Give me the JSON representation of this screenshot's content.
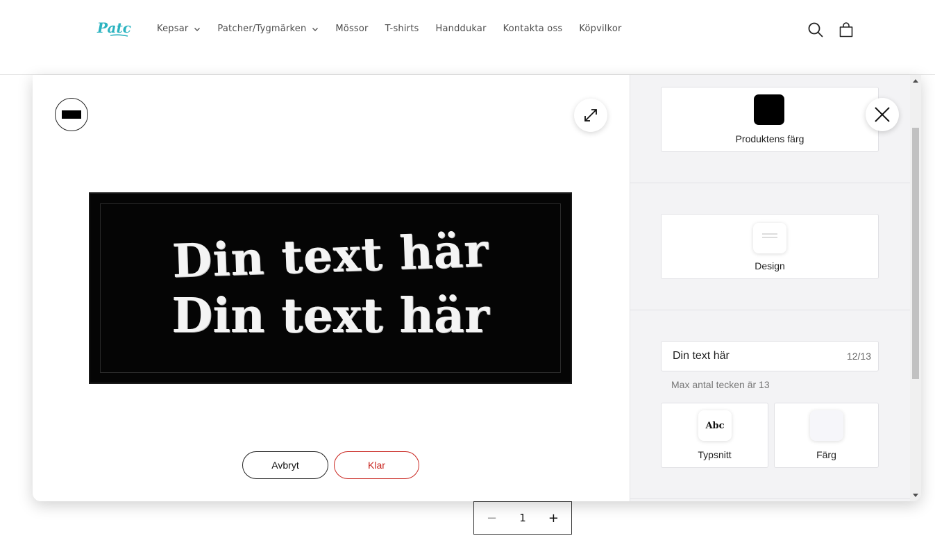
{
  "header": {
    "logo_text": "Patch",
    "nav": [
      {
        "label": "Kepsar",
        "dropdown": true
      },
      {
        "label": "Patcher/Tygmärken",
        "dropdown": true
      },
      {
        "label": "Mössor",
        "dropdown": false
      },
      {
        "label": "T-shirts",
        "dropdown": false
      },
      {
        "label": "Handdukar",
        "dropdown": false
      },
      {
        "label": "Kontakta oss",
        "dropdown": false
      },
      {
        "label": "Köpvilkor",
        "dropdown": false
      }
    ],
    "icons": [
      "search-icon",
      "cart-icon"
    ]
  },
  "quantity": {
    "minus": "−",
    "value": "1",
    "plus": "+"
  },
  "editor": {
    "patch": {
      "line1": "Din text här",
      "line2": "Din text här",
      "background_color": "#050505",
      "text_color": "#f4f4f4"
    },
    "buttons": {
      "cancel": "Avbryt",
      "done": "Klar"
    },
    "panel": {
      "product_color_label": "Produktens färg",
      "product_color": "#000000",
      "design_label": "Design",
      "text_value": "Din text här",
      "char_count": "12/13",
      "hint": "Max antal tecken är 13",
      "font_label": "Typsnitt",
      "font_sample": "Abc",
      "color_label": "Färg"
    }
  },
  "colors": {
    "accent_red": "#c9251f",
    "logo_teal": "#2bb3c0"
  }
}
